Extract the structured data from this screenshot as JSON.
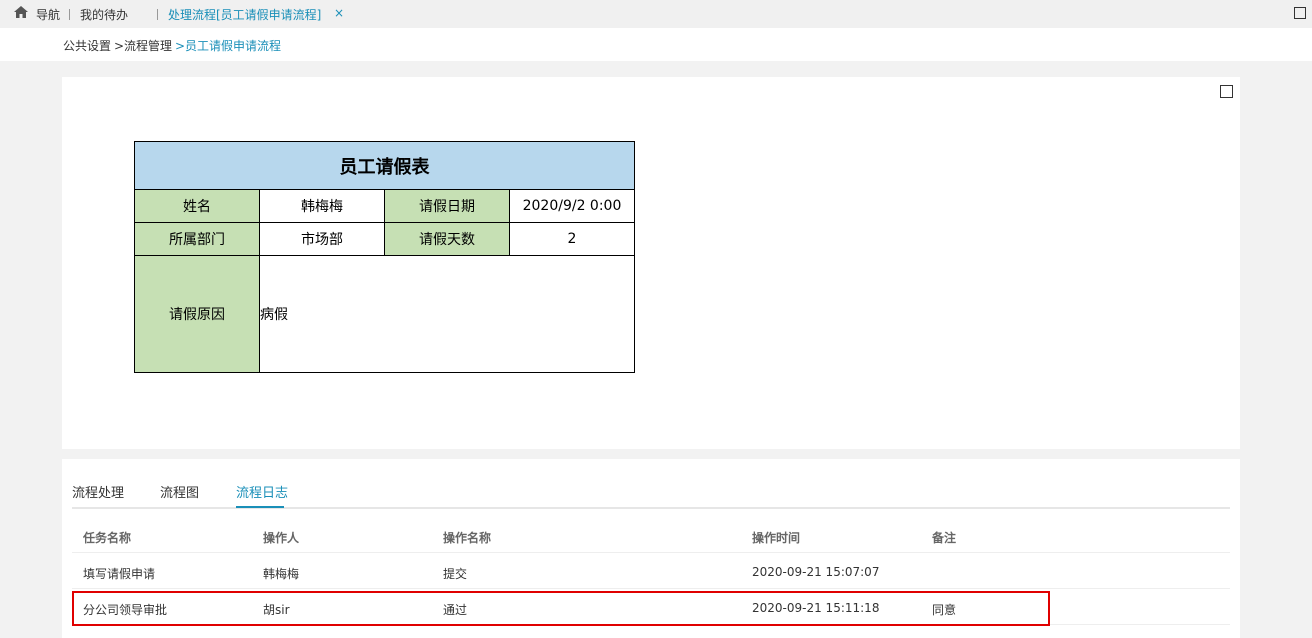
{
  "topbar": {
    "nav": "导航",
    "todo": "我的待办",
    "active_tab": "处理流程[员工请假申请流程]",
    "close": "×"
  },
  "breadcrumb": {
    "root": "公共设置",
    "mid": ">流程管理",
    "current": ">员工请假申请流程"
  },
  "form": {
    "title": "员工请假表",
    "name_label": "姓名",
    "name_value": "韩梅梅",
    "date_label": "请假日期",
    "date_value": "2020/9/2 0:00",
    "dept_label": "所属部门",
    "dept_value": "市场部",
    "days_label": "请假天数",
    "days_value": "2",
    "reason_label": "请假原因",
    "reason_value": "病假"
  },
  "tabs": [
    "流程处理",
    "流程图",
    "流程日志"
  ],
  "log": {
    "columns": [
      "任务名称",
      "操作人",
      "操作名称",
      "操作时间",
      "备注"
    ],
    "rows": [
      [
        "填写请假申请",
        "韩梅梅",
        "提交",
        "2020-09-21 15:07:07",
        ""
      ],
      [
        "分公司领导审批",
        "胡sir",
        "通过",
        "2020-09-21 15:11:18",
        "同意"
      ]
    ]
  },
  "colors": {
    "accent": "#1a8fb8",
    "header_fill": "#b7d7ed",
    "label_fill": "#c6e0b4",
    "highlight": "#e00000"
  }
}
